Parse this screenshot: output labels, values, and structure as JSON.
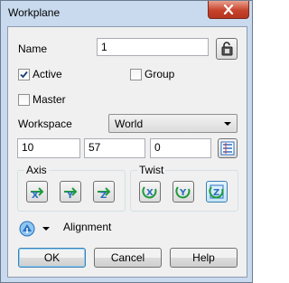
{
  "window": {
    "title": "Workplane"
  },
  "name": {
    "label": "Name",
    "value": "1"
  },
  "active": {
    "label": "Active",
    "checked": true
  },
  "group": {
    "label": "Group",
    "checked": false
  },
  "master": {
    "label": "Master",
    "checked": false
  },
  "workspace": {
    "label": "Workspace",
    "selected": "World"
  },
  "coords": {
    "x": "10",
    "y": "57",
    "z": "0"
  },
  "axis": {
    "label": "Axis"
  },
  "twist": {
    "label": "Twist"
  },
  "alignment": {
    "label": "Alignment"
  },
  "buttons": {
    "ok": "OK",
    "cancel": "Cancel",
    "help": "Help"
  },
  "colors": {
    "accent_blue": "#2a6fc0",
    "arrow_green": "#1f9a3c",
    "title_bar": "#c9daee"
  }
}
